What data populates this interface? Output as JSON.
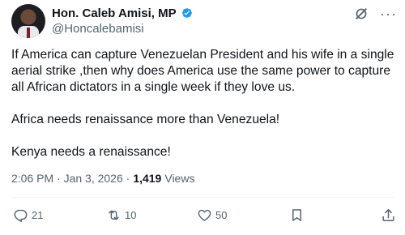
{
  "author": {
    "display_name": "Hon. Caleb Amisi, MP",
    "handle": "@Honcalebamisi",
    "verified_color": "#1d9bf0"
  },
  "tweet": {
    "paragraph_1": "If America can capture Venezuelan President and his wife in a single aerial strike ,then why does America use the same power to capture all African dictators in a single week if they love us.",
    "paragraph_2": "Africa needs renaissance more than Venezuela!",
    "paragraph_3": "Kenya needs a renaissance!"
  },
  "meta": {
    "timestamp": "2:06 PM · Jan 3, 2026 ·",
    "views_count": "1,419",
    "views_label": "Views"
  },
  "actions": {
    "replies": "21",
    "reposts": "10",
    "likes": "50"
  },
  "icons": {
    "top_right": [
      "grok-icon",
      "more-icon"
    ],
    "action_bar": [
      "reply-icon",
      "repost-icon",
      "like-icon",
      "bookmark-icon",
      "share-icon"
    ]
  },
  "colors": {
    "text_primary": "#0f1419",
    "text_secondary": "#536471",
    "accent": "#1d9bf0"
  }
}
